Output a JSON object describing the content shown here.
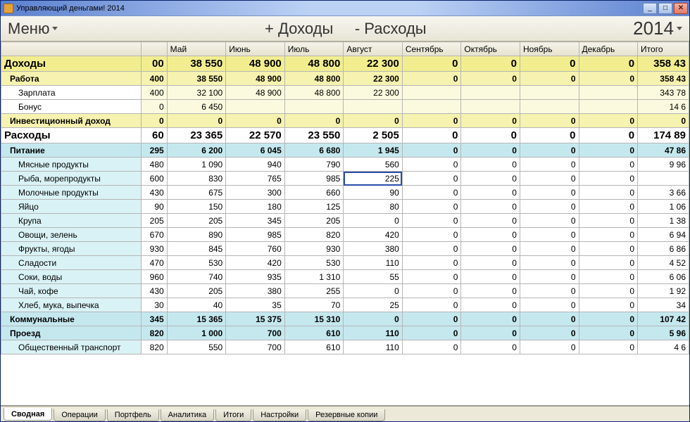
{
  "window": {
    "title": "Управляющий деньгами! 2014"
  },
  "toolbar": {
    "menu_label": "Меню",
    "income_btn": "+ Доходы",
    "expense_btn": "- Расходы",
    "year": "2014"
  },
  "columns": {
    "months": [
      "Май",
      "Июнь",
      "Июль",
      "Август",
      "Сентябрь",
      "Октябрь",
      "Ноябрь",
      "Декабрь"
    ],
    "total": "Итого"
  },
  "rows": [
    {
      "id": "income",
      "kind": "income-head",
      "label": "Доходы",
      "partial": "00",
      "vals": [
        "38 550",
        "48 900",
        "48 800",
        "22 300",
        "0",
        "0",
        "0",
        "0"
      ],
      "total": "358 43"
    },
    {
      "id": "work",
      "kind": "income-sub",
      "label": "Работа",
      "partial": "400",
      "vals": [
        "38 550",
        "48 900",
        "48 800",
        "22 300",
        "0",
        "0",
        "0",
        "0"
      ],
      "total": "358 43"
    },
    {
      "id": "salary",
      "kind": "income-leaf",
      "label": "Зарплата",
      "partial": "400",
      "vals": [
        "32 100",
        "48 900",
        "48 800",
        "22 300",
        "",
        "",
        "",
        ""
      ],
      "total": "343 78"
    },
    {
      "id": "bonus",
      "kind": "income-leaf",
      "label": "Бонус",
      "partial": "0",
      "vals": [
        "6 450",
        "",
        "",
        "",
        "",
        "",
        "",
        ""
      ],
      "total": "14 6"
    },
    {
      "id": "invest",
      "kind": "income-sub",
      "label": "Инвестиционный доход",
      "partial": "0",
      "vals": [
        "0",
        "0",
        "0",
        "0",
        "0",
        "0",
        "0",
        "0"
      ],
      "total": "0"
    },
    {
      "id": "expense",
      "kind": "expense-head",
      "label": "Расходы",
      "partial": "60",
      "vals": [
        "23 365",
        "22 570",
        "23 550",
        "2 505",
        "0",
        "0",
        "0",
        "0"
      ],
      "total": "174 89"
    },
    {
      "id": "food",
      "kind": "expense-sub",
      "label": "Питание",
      "partial": "295",
      "vals": [
        "6 200",
        "6 045",
        "6 680",
        "1 945",
        "0",
        "0",
        "0",
        "0"
      ],
      "total": "47 86"
    },
    {
      "id": "meat",
      "kind": "expense-leaf",
      "label": "Мясные продукты",
      "partial": "480",
      "vals": [
        "1 090",
        "940",
        "790",
        "560",
        "0",
        "0",
        "0",
        "0"
      ],
      "total": "9 96"
    },
    {
      "id": "fish",
      "kind": "expense-leaf",
      "label": "Рыба, морепродукты",
      "partial": "600",
      "vals": [
        "830",
        "765",
        "985",
        "225",
        "0",
        "0",
        "0",
        "0"
      ],
      "total": "",
      "selected_col": 3
    },
    {
      "id": "dairy",
      "kind": "expense-leaf",
      "label": "Молочные продукты",
      "partial": "430",
      "vals": [
        "675",
        "300",
        "660",
        "90",
        "0",
        "0",
        "0",
        "0"
      ],
      "total": "3 66"
    },
    {
      "id": "egg",
      "kind": "expense-leaf",
      "label": "Яйцо",
      "partial": "90",
      "vals": [
        "150",
        "180",
        "125",
        "80",
        "0",
        "0",
        "0",
        "0"
      ],
      "total": "1 06"
    },
    {
      "id": "grain",
      "kind": "expense-leaf",
      "label": "Крупа",
      "partial": "205",
      "vals": [
        "205",
        "345",
        "205",
        "0",
        "0",
        "0",
        "0",
        "0"
      ],
      "total": "1 38"
    },
    {
      "id": "veg",
      "kind": "expense-leaf",
      "label": "Овощи, зелень",
      "partial": "670",
      "vals": [
        "890",
        "985",
        "820",
        "420",
        "0",
        "0",
        "0",
        "0"
      ],
      "total": "6 94"
    },
    {
      "id": "fruit",
      "kind": "expense-leaf",
      "label": "Фрукты, ягоды",
      "partial": "930",
      "vals": [
        "845",
        "760",
        "930",
        "380",
        "0",
        "0",
        "0",
        "0"
      ],
      "total": "6 86"
    },
    {
      "id": "sweets",
      "kind": "expense-leaf",
      "label": "Сладости",
      "partial": "470",
      "vals": [
        "530",
        "420",
        "530",
        "110",
        "0",
        "0",
        "0",
        "0"
      ],
      "total": "4 52"
    },
    {
      "id": "juice",
      "kind": "expense-leaf",
      "label": "Соки, воды",
      "partial": "960",
      "vals": [
        "740",
        "935",
        "1 310",
        "55",
        "0",
        "0",
        "0",
        "0"
      ],
      "total": "6 06"
    },
    {
      "id": "tea",
      "kind": "expense-leaf",
      "label": "Чай, кофе",
      "partial": "430",
      "vals": [
        "205",
        "380",
        "255",
        "0",
        "0",
        "0",
        "0",
        "0"
      ],
      "total": "1 92"
    },
    {
      "id": "bread",
      "kind": "expense-leaf",
      "label": "Хлеб, мука, выпечка",
      "partial": "30",
      "vals": [
        "40",
        "35",
        "70",
        "25",
        "0",
        "0",
        "0",
        "0"
      ],
      "total": "34"
    },
    {
      "id": "utilities",
      "kind": "expense-sub",
      "label": "Коммунальные",
      "partial": "345",
      "vals": [
        "15 365",
        "15 375",
        "15 310",
        "0",
        "0",
        "0",
        "0",
        "0"
      ],
      "total": "107 42"
    },
    {
      "id": "transport",
      "kind": "expense-sub",
      "label": "Проезд",
      "partial": "820",
      "vals": [
        "1 000",
        "700",
        "610",
        "110",
        "0",
        "0",
        "0",
        "0"
      ],
      "total": "5 96"
    },
    {
      "id": "pubtrans",
      "kind": "expense-leaf",
      "label": "Общественный транспорт",
      "partial": "820",
      "vals": [
        "550",
        "700",
        "610",
        "110",
        "0",
        "0",
        "0",
        "0"
      ],
      "total": "4 6"
    }
  ],
  "tabs": [
    "Сводная",
    "Операции",
    "Портфель",
    "Аналитика",
    "Итоги",
    "Настройки",
    "Резервные копии"
  ],
  "active_tab": 0
}
